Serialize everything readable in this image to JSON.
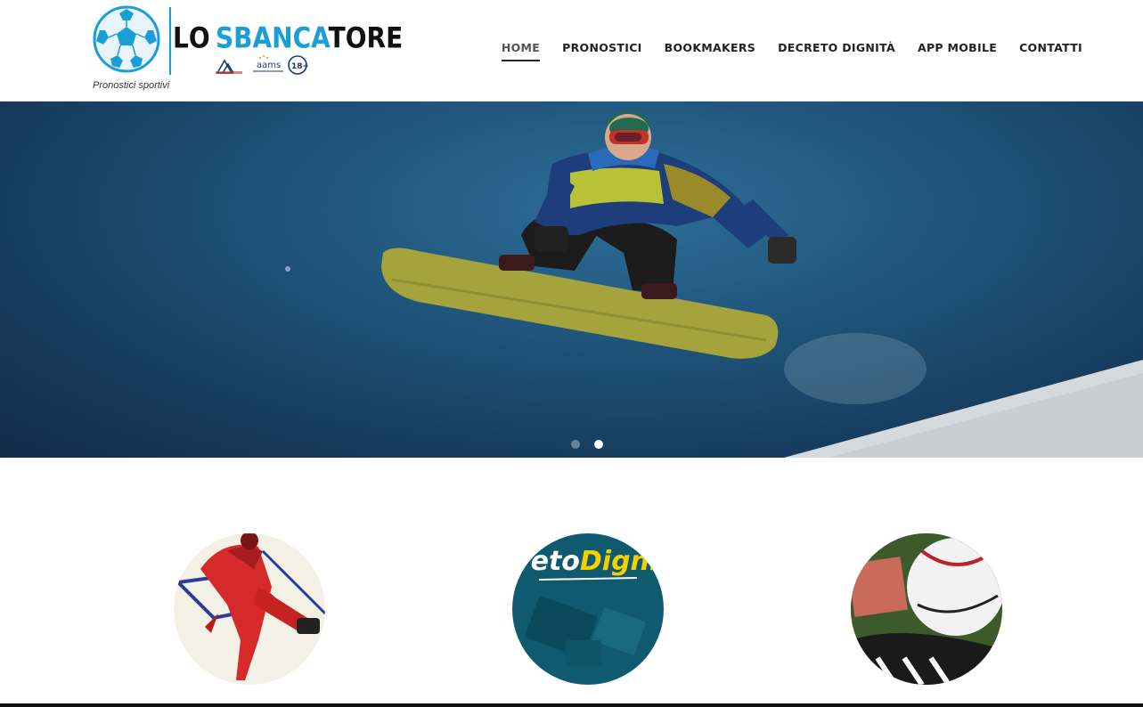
{
  "header": {
    "logo": {
      "brand_left": "LO",
      "brand_blue": "SBANCA",
      "brand_dark": "TORE",
      "tagline": "Pronostici sportivi",
      "badge_age": "18+"
    },
    "nav": [
      {
        "label": "HOME",
        "active": true
      },
      {
        "label": "PRONOSTICI"
      },
      {
        "label": "BOOKMAKERS"
      },
      {
        "label": "DECRETO DIGNITÀ"
      },
      {
        "label": "APP MOBILE"
      },
      {
        "label": "CONTATTI"
      }
    ]
  },
  "hero": {
    "slides": 2,
    "active_slide": 2
  },
  "features": [
    {
      "name": "football-player-image"
    },
    {
      "name": "decreto-dignita-image",
      "text_white": "reto",
      "text_yellow": "Digni"
    },
    {
      "name": "ball-and-money-image"
    }
  ],
  "colors": {
    "brand_blue": "#1a9ed6",
    "nav_text": "#222222",
    "hero_sky": "#1f5278"
  }
}
